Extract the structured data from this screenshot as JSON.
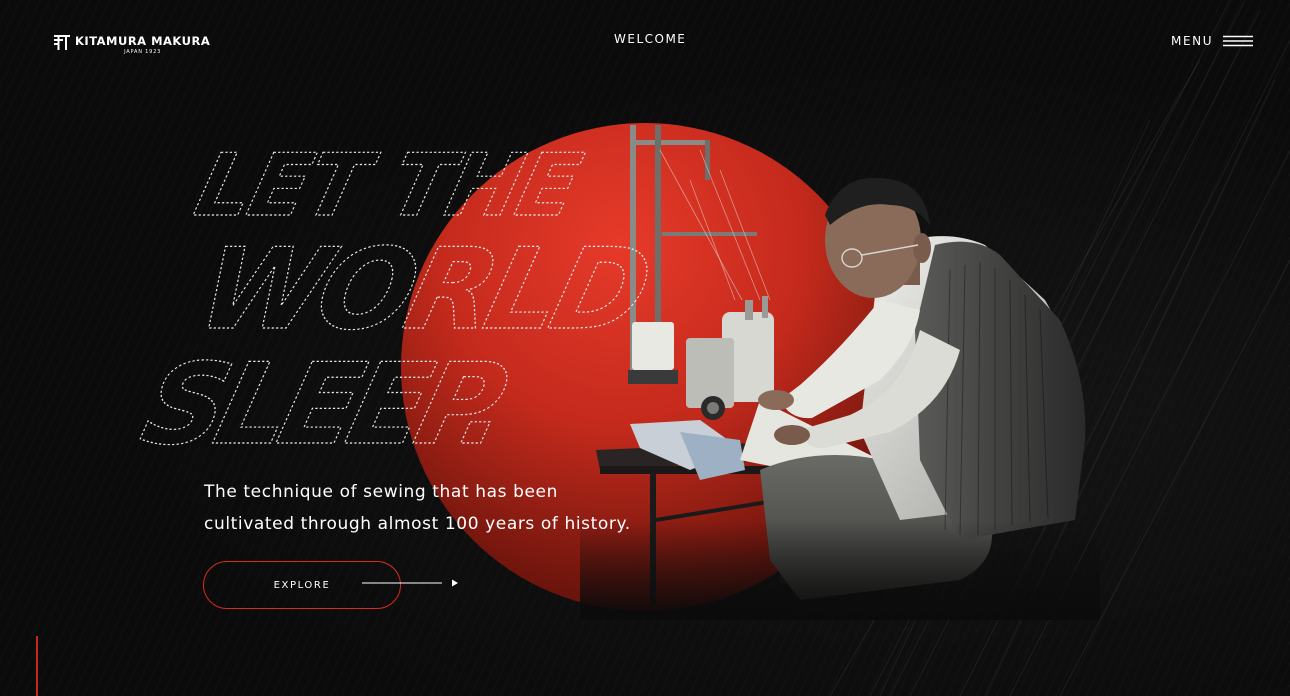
{
  "brand": {
    "name": "KITAMURA MAKURA",
    "subtitle": "JAPAN 1923",
    "logo_icon": "kitamura-mark-icon"
  },
  "header": {
    "center_label": "WELCOME",
    "menu_label": "MENU",
    "menu_icon": "hamburger-icon"
  },
  "hero": {
    "headline_lines": [
      "LET THE",
      "WORLD",
      "SLEEP."
    ],
    "tagline_lines": [
      "The technique of sewing that has been",
      "cultivated through almost 100 years of history."
    ],
    "cta_label": "EXPLORE",
    "cta_icon": "arrow-right-icon",
    "image_alt": "craftsman-at-sewing-machine"
  },
  "colors": {
    "background": "#0b0b0b",
    "accent_red": "#d62b1d",
    "text": "#ffffff"
  }
}
